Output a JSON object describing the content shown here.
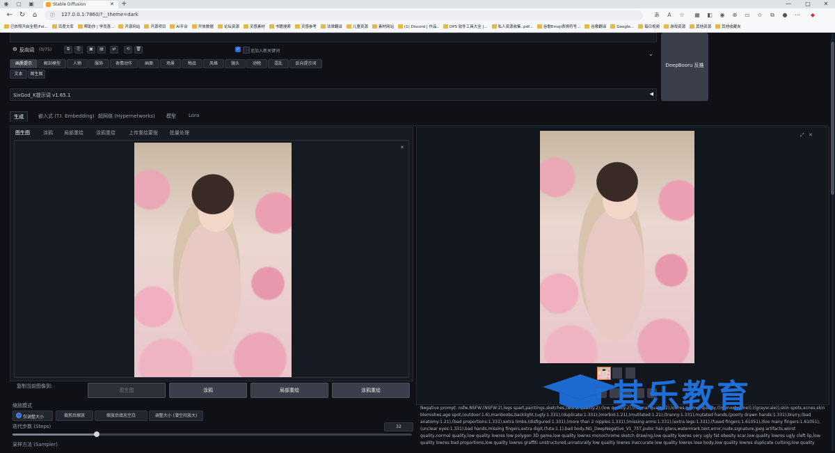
{
  "browser": {
    "tab_title": "Stable Diffusion",
    "url": "127.0.0.1:7860/?__theme=dark",
    "bookmarks": [
      "已依照开启全程(Fol...",
      "百度文库",
      "帮助你 | 学而喜...",
      "开源网站",
      "开源项目",
      "AI平台",
      "开放数据",
      "论坛资源",
      "灵感素材",
      "书籍搜索",
      "灵感参考",
      "法律翻译",
      "儿童资源",
      "素材网站",
      "(1) Discord | 作品..",
      "DPS 软件工具大全 |...",
      "私人资源收集..pdf...",
      "谷歌Emoji表情符号...",
      "谷歌翻译",
      "Google...",
      "每日视频",
      "游戏资源",
      "其他资源",
      "其他收藏夹"
    ]
  },
  "negative": {
    "title": "反向词",
    "count": "(0/75)",
    "checkbox_label": "追加入新关键词",
    "categories": [
      "画质提示",
      "解剖模型",
      "人物",
      "服饰",
      "表情动作",
      "画面",
      "场景",
      "物品",
      "风格",
      "镜头",
      "动物",
      "混乱",
      "反向提示词"
    ],
    "subtabs": [
      "文本",
      "图生图"
    ]
  },
  "deepbooru_button": "DeepBooru 反推",
  "extension_title": "SixGod_K提示词 v1.65.1",
  "main_tabs": [
    "生成",
    "嵌入式 (T.I. Embedding)",
    "超网络 (Hypernetworks)",
    "模型",
    "Lora"
  ],
  "img_tabs": [
    "图生图",
    "涂鸦",
    "局部重绘",
    "涂鸦重绘",
    "上传重绘蒙版",
    "批量处理"
  ],
  "copy_label": "复制当前图像到:",
  "copy_buttons": [
    "图生图",
    "涂鸦",
    "局部重绘",
    "涂鸦重绘"
  ],
  "resize": {
    "label": "缩放模式",
    "options": [
      "仅调整大小",
      "裁剪后缩放",
      "缩放后填充空白",
      "调整大小 (潜空间放大)"
    ]
  },
  "steps": {
    "label": "迭代步数 (Steps)",
    "value": "32",
    "fraction": 0.21
  },
  "sampler_label": "采样方法 (Sampler)",
  "negative_prompt_output": "Negative prompt: nsfw,NSFW,(NSFW:2),legs spart,paintings,sketches,(worst quality:2),(low quality:2),(normal quality:2),lowres,normal quality,((monochrome)),((grayscale)),skin spots,acnes,skin blemishes,age spot,(outdoor:1.6),manboobs,backlight,(ugly:1.331),(duplicate:1.331),(morbid:1.21),(mutilated:1.21),(tranny:1.331),mutated hands,(poorly drawn hands:1.331),blurry,(bad anatomy:1.21),(bad proportions:1.331),extra limbs,(disfigured:1.331),(more than 2 nipples:1.331),(missing arms:1.331),(extra legs:1.331),(fused fingers:1.61051),(too many fingers:1.61051),(unclear eyes:1.331),bad hands,missing fingers,extra digit,(futa:1.1),bad body,NG_DeepNegative_V1_75T,pubic hair,glans,watermark,text,error,nude,signature,jpeg artifacts,worst quality,normal quality,low quality lowres low polygon 3D game,low quality lowres monochrome sketch drawing,low quality lowres very ugly fat obesity scar,low quality lowres ugly cleft lip,low quality lowres bad proportions,low quality lowres graffiti unstructured,unnaturally low quality lowres inaccurate low quality lowres lose body,low quality lowres duplicate curbing,low quality lowres sketch",
  "watermark": "其乐教育",
  "colors": {
    "accent": "#1e6fd9",
    "bg": "#0f1117"
  }
}
